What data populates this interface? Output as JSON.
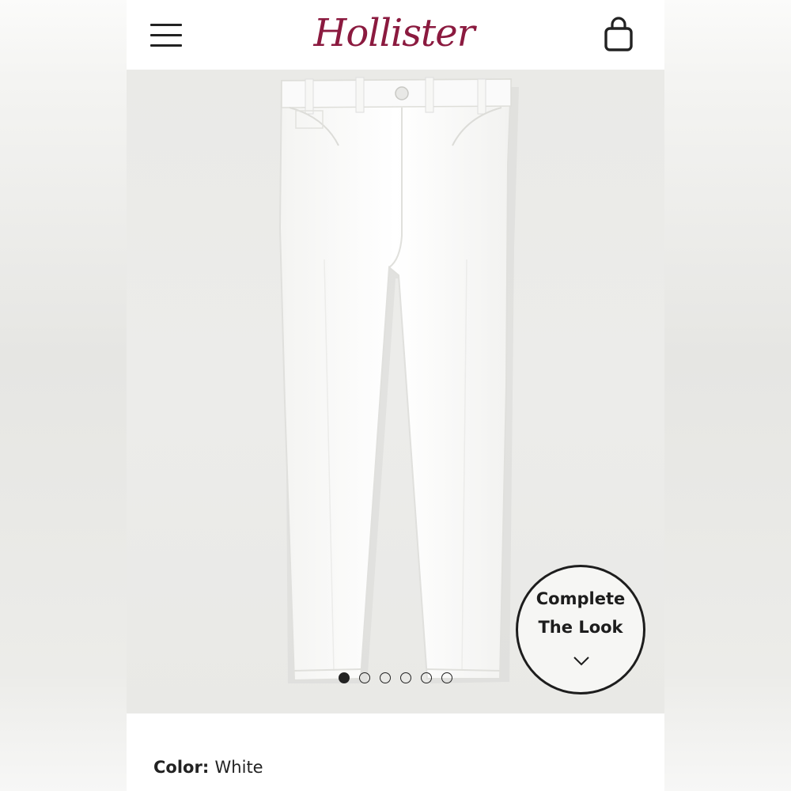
{
  "header": {
    "brand": "Hollister",
    "menu_icon": "hamburger-menu-icon",
    "bag_icon": "shopping-bag-icon",
    "brand_color": "#8b1a3f"
  },
  "gallery": {
    "image_description_icon": "product-image",
    "slides_total": 6,
    "active_slide": 1,
    "complete_look": {
      "line1": "Complete",
      "line2": "The Look",
      "icon": "chevron-down-icon"
    }
  },
  "product": {
    "color_label": "Color:",
    "color_value": "White"
  }
}
